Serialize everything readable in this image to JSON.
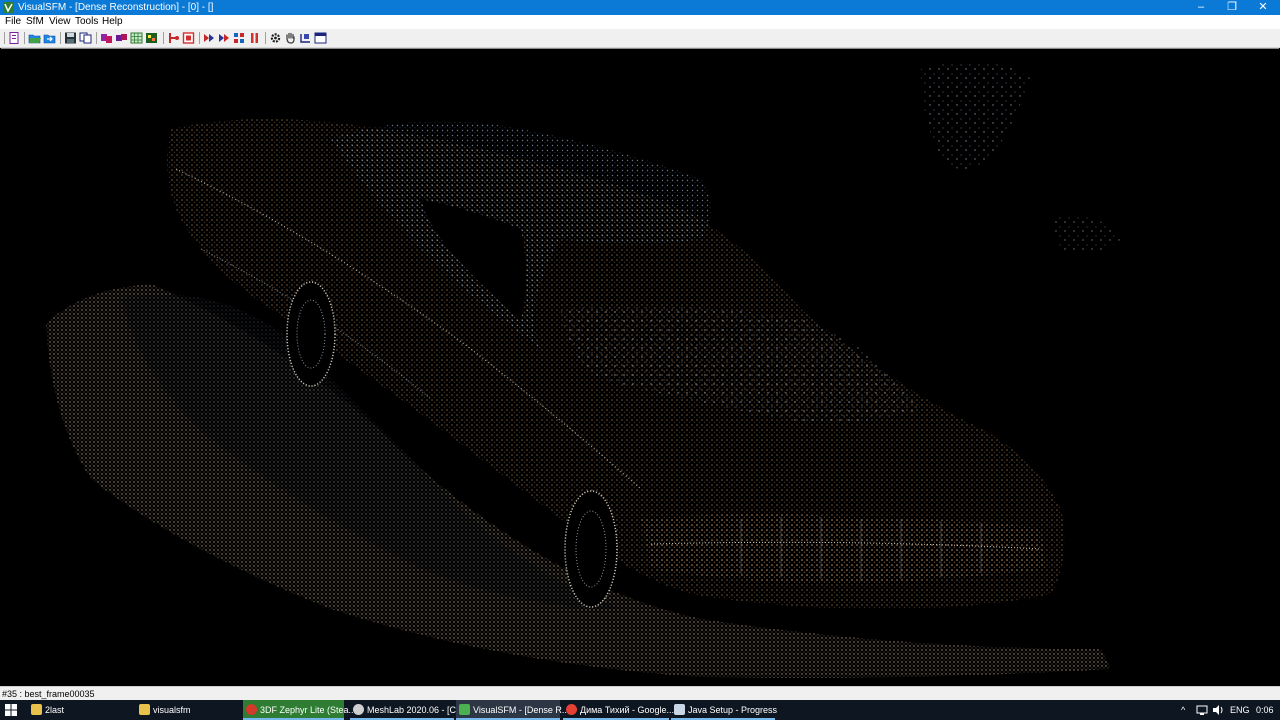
{
  "window": {
    "title": "VisualSFM - [Dense Reconstruction] - [0] - []",
    "controls": {
      "minimize": "–",
      "maximize": "❐",
      "close": "✕"
    }
  },
  "menu": [
    "File",
    "SfM",
    "View",
    "Tools",
    "Help"
  ],
  "toolbar": {
    "icons": [
      "log-icon",
      "open-images-icon",
      "open-multi-icon",
      "save-icon",
      "copy-icon",
      "pairwise-match-icon",
      "match-icon",
      "grid-icon",
      "show-matrix-icon",
      "reconstruct-icon",
      "stop-icon",
      "sfm-run-icon",
      "dense-run-icon",
      "cmvs-icon",
      "pause-icon",
      "settings-icon",
      "hand-icon",
      "frame-icon",
      "window-icon"
    ]
  },
  "viewport": {
    "content": "dense point cloud of a car"
  },
  "status": {
    "text": "#35 : best_frame00035"
  },
  "taskbar": {
    "tasks": [
      {
        "label": "2last",
        "icon": "folder-icon",
        "color": "#e8c24a"
      },
      {
        "label": "visualsfm",
        "icon": "folder-icon",
        "color": "#e8c24a"
      },
      {
        "label": "3DF Zephyr Lite (Stea...",
        "icon": "zephyr-icon",
        "color": "#d23a2a",
        "highlight": "#2e7d32"
      },
      {
        "label": "MeshLab 2020.06 - [C...",
        "icon": "meshlab-icon",
        "color": "#cfcfcf"
      },
      {
        "label": "VisualSFM - [Dense R...",
        "icon": "visualsfm-icon",
        "color": "#4caf50"
      },
      {
        "label": "Дима Тихий - Google...",
        "icon": "chrome-icon",
        "color": "#e44134"
      },
      {
        "label": "Java Setup - Progress",
        "icon": "java-icon",
        "color": "#c9d6e6"
      }
    ],
    "tray": {
      "lang": "ENG",
      "time": "0:06"
    }
  }
}
